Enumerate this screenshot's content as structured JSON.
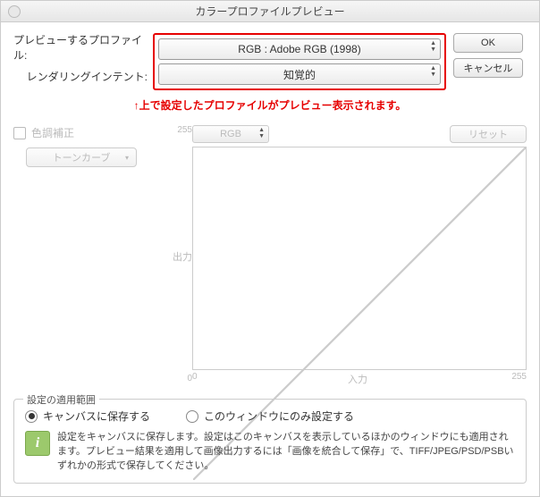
{
  "title": "カラープロファイルプレビュー",
  "buttons": {
    "ok": "OK",
    "cancel": "キャンセル"
  },
  "fields": {
    "profile_label": "プレビューするプロファイル:",
    "profile_value": "RGB : Adobe RGB (1998)",
    "intent_label": "レンダリングインテント:",
    "intent_value": "知覚的"
  },
  "hint": "↑上で設定したプロファイルがプレビュー表示されます。",
  "tone": {
    "checkbox_label": "色調補正",
    "curve_button": "トーンカーブ",
    "channel": "RGB",
    "reset": "リセット"
  },
  "chart_data": {
    "type": "line",
    "x": [
      0,
      255
    ],
    "y": [
      0,
      255
    ],
    "xlabel": "入力",
    "ylabel": "出力",
    "xlim": [
      0,
      255
    ],
    "ylim": [
      0,
      255
    ],
    "ticks": {
      "x": [
        "0",
        "255"
      ],
      "y": [
        "255",
        "0"
      ]
    }
  },
  "scope": {
    "title": "設定の適用範囲",
    "opt_canvas": "キャンバスに保存する",
    "opt_window": "このウィンドウにのみ設定する",
    "info": "設定をキャンバスに保存します。設定はこのキャンバスを表示しているほかのウィンドウにも適用されます。プレビュー結果を適用して画像出力するには「画像を統合して保存」で、TIFF/JPEG/PSD/PSBいずれかの形式で保存してください。"
  }
}
